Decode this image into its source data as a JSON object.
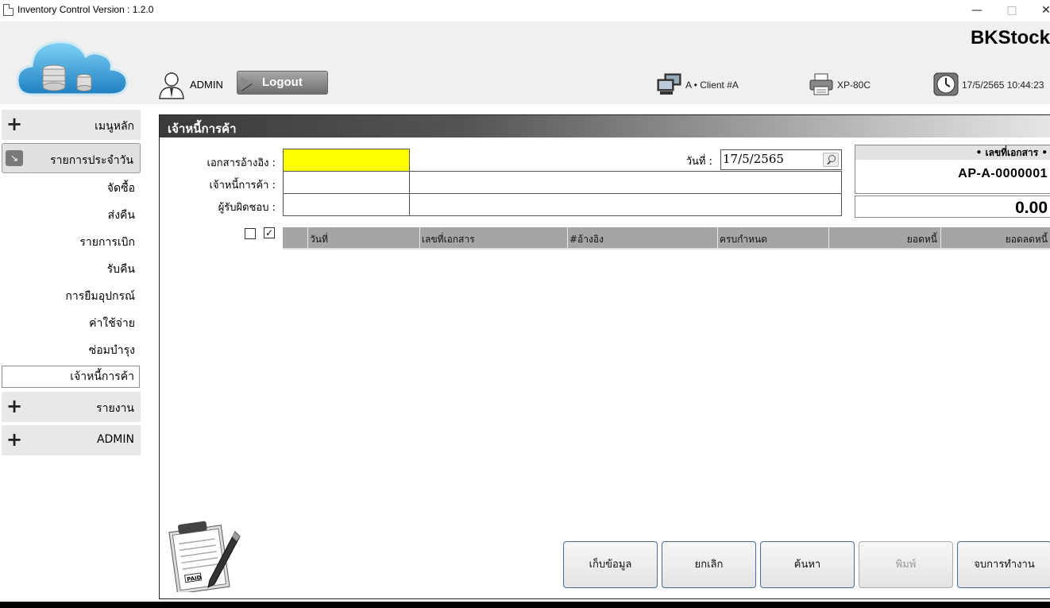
{
  "window": {
    "title": "Inventory Control Version : 1.2.0",
    "minimize": "—",
    "maximize": "□",
    "close": "✕"
  },
  "header": {
    "brand": "BKStock",
    "user": "ADMIN",
    "logout_label": "Logout",
    "client": "A • Client #A",
    "printer": "XP-80C",
    "datetime": "17/5/2565 10:44:23"
  },
  "sidebar": {
    "main_menu": "เมนูหลัก",
    "daily": "รายการประจำวัน",
    "items": [
      "จัดซื้อ",
      "ส่งคืน",
      "รายการเบิก",
      "รับคืน",
      "การยืมอุปกรณ์",
      "ค่าใช้จ่าย",
      "ซ่อมบำรุง",
      "เจ้าหนี้การค้า"
    ],
    "reports": "รายงาน",
    "admin": "ADMIN"
  },
  "panel": {
    "title": "เจ้าหนี้การค้า",
    "ref_label": "เอกสารอ้างอิง :",
    "creditor_label": "เจ้าหนี้การค้า :",
    "responsible_label": "ผู้รับผิดชอบ :",
    "date_label": "วันที่ :",
    "date_value": "17/5/2565",
    "doc_no_label": "• เลขที่เอกสาร •",
    "doc_no_value": "AP-A-0000001",
    "amount": "0.00",
    "checkbox_checked": "✓"
  },
  "grid": {
    "columns": [
      "วันที่",
      "เลขที่เอกสาร",
      "#อ้างอิง",
      "ครบกำหนด",
      "ยอดหนี้",
      "ยอดลดหนี้"
    ]
  },
  "buttons": {
    "save": "เก็บข้อมูล",
    "cancel": "ยกเลิก",
    "search": "ค้นหา",
    "print": "พิมพ์",
    "finish": "จบการทำงาน"
  },
  "colors": {
    "required_field": "#ffff00",
    "button_border": "#4a6a9a"
  }
}
